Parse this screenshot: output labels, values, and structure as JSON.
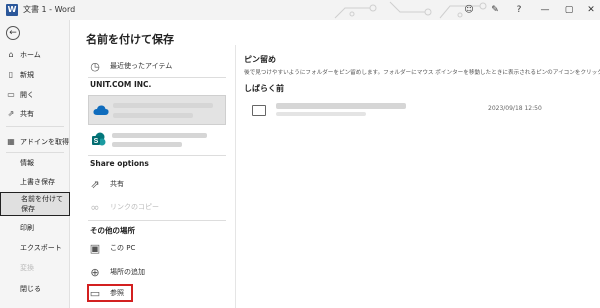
{
  "titlebar": {
    "doc_title": "文書 1  -  Word",
    "help": "?"
  },
  "sidebar": {
    "items": [
      {
        "label": "ホーム",
        "icon": "home-icon"
      },
      {
        "label": "新規",
        "icon": "new-document-icon"
      },
      {
        "label": "開く",
        "icon": "folder-open-icon"
      },
      {
        "label": "共有",
        "icon": "share-icon"
      },
      {
        "label": "アドインを取得",
        "icon": "addin-icon"
      },
      {
        "label": "情報"
      },
      {
        "label": "上書き保存"
      },
      {
        "label": "名前を付けて保存"
      },
      {
        "label": "印刷"
      },
      {
        "label": "エクスポート"
      },
      {
        "label": "変換"
      },
      {
        "label": "閉じる"
      }
    ]
  },
  "main": {
    "title": "名前を付けて保存"
  },
  "locations": {
    "recent": "最近使ったアイテム",
    "org_label": "UNIT.COM INC.",
    "share_options_label": "Share options",
    "share": "共有",
    "copy_link": "リンクのコピー",
    "other_places_label": "その他の場所",
    "this_pc": "この PC",
    "add_place": "場所の追加",
    "browse": "参照"
  },
  "right": {
    "pinned_title": "ピン留め",
    "pinned_desc": "後で見つけやすいようにフォルダーをピン留めします。フォルダーにマウス ポインターを移動したときに表示されるピンのアイコンをクリックします。",
    "recent_title": "しばらく前",
    "recent_item_date": "2023/09/18 12:50"
  }
}
